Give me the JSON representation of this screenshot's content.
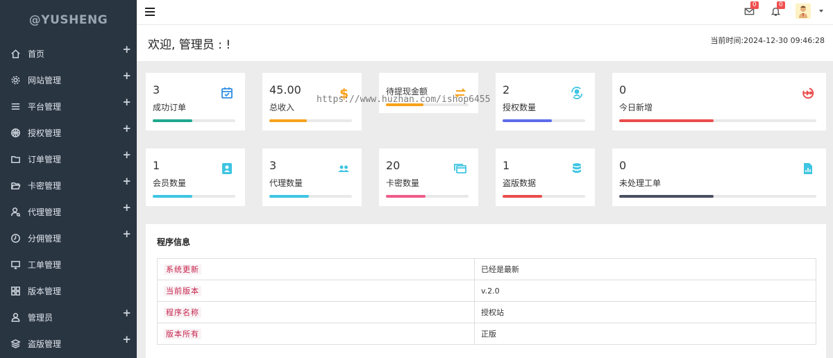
{
  "brand": "@YUSHENG",
  "sidebar": {
    "items": [
      {
        "label": "首页",
        "plus": "+"
      },
      {
        "label": "网站管理",
        "plus": "+"
      },
      {
        "label": "平台管理",
        "plus": "+"
      },
      {
        "label": "授权管理",
        "plus": "+"
      },
      {
        "label": "订单管理",
        "plus": "+"
      },
      {
        "label": "卡密管理",
        "plus": "+"
      },
      {
        "label": "代理管理",
        "plus": "+"
      },
      {
        "label": "分佣管理",
        "plus": "+"
      },
      {
        "label": "工单管理",
        "plus": ""
      },
      {
        "label": "版本管理",
        "plus": ""
      },
      {
        "label": "管理员",
        "plus": "+"
      },
      {
        "label": "盗版管理",
        "plus": "+"
      }
    ]
  },
  "topbar": {
    "mail_badge": "0",
    "bell_badge": "0"
  },
  "welcome": {
    "title": "欢迎, 管理员 : !",
    "time": "当前时间:2024-12-30 09:46:28"
  },
  "stats": [
    {
      "value": "3",
      "label": "成功订单",
      "icon": "calendar-check-icon",
      "color": "#1fa88f",
      "progress": 0.48
    },
    {
      "value": "45.00",
      "label": "总收入",
      "icon": "dollar-icon",
      "color": "#f7a21b",
      "progress": 0.45
    },
    {
      "value": "",
      "label": "待提现金额",
      "icon": "withdraw-icon",
      "color": "#f7a21b",
      "progress": 0.45
    },
    {
      "value": "2",
      "label": "授权数量",
      "icon": "user-sync-icon",
      "color": "#5d6bea",
      "progress": 0.6
    },
    {
      "value": "0",
      "label": "今日新增",
      "icon": "login-circle-icon",
      "color": "#ea4d4d",
      "progress": 0.48
    },
    {
      "value": "1",
      "label": "会员数量",
      "icon": "contact-card-icon",
      "color": "#3ec5e2",
      "progress": 0.48
    },
    {
      "value": "3",
      "label": "代理数量",
      "icon": "users-icon",
      "color": "#3ec5e2",
      "progress": 0.48
    },
    {
      "value": "20",
      "label": "卡密数量",
      "icon": "cards-icon",
      "color": "#ef5b8a",
      "progress": 0.48
    },
    {
      "value": "1",
      "label": "盗版数据",
      "icon": "database-icon",
      "color": "#ea4d4d",
      "progress": 0.48
    },
    {
      "value": "0",
      "label": "未处理工单",
      "icon": "report-icon",
      "color": "#4a5060",
      "progress": 0.48
    }
  ],
  "watermark": "https://www.huzhan.com/ishop6455",
  "program_info": {
    "title": "程序信息",
    "rows": [
      {
        "key": "系统更新",
        "value": "已经是最新"
      },
      {
        "key": "当前版本",
        "value": "v.2.0"
      },
      {
        "key": "程序名称",
        "value": "授权站"
      },
      {
        "key": "版本所有",
        "value": "正版"
      }
    ]
  }
}
